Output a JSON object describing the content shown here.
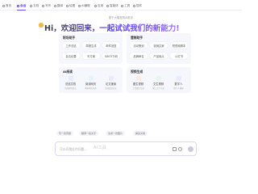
{
  "tabs": [
    {
      "label": "首页",
      "active": false
    },
    {
      "label": "会话",
      "active": true
    },
    {
      "label": "文档",
      "active": false
    },
    {
      "label": "写作",
      "active": false
    },
    {
      "label": "翻译",
      "active": false
    },
    {
      "label": "绘图",
      "active": false
    },
    {
      "label": "AI编程",
      "active": false
    },
    {
      "label": "应用",
      "active": false
    },
    {
      "label": "智能体",
      "active": false
    },
    {
      "label": "工具",
      "active": false
    },
    {
      "label": "插件",
      "active": false
    }
  ],
  "subtitle": "基于大模型的AI助手",
  "greeting": "Hi，欢迎回来，一起试试我们的新能力!",
  "cards": {
    "left_top": {
      "title": "职场助手",
      "items": [
        "工作总结",
        "周报生成",
        "邮件回复",
        "会议纪要",
        "写方案",
        "SWOT分析"
      ]
    },
    "right_top": {
      "title": "营销助手",
      "items": [
        "活动策划",
        "营销文案",
        "短视频脚本",
        "品牌命名",
        "产品卖点",
        "小红书"
      ]
    },
    "left_bottom": {
      "title": "AI阅读",
      "items": [
        {
          "label": "总结文档",
          "desc": "快速提炼要点"
        },
        {
          "label": "阅读网页",
          "desc": "解析网页内容"
        },
        {
          "label": "论文速读",
          "desc": "高效阅读论文"
        }
      ]
    },
    "right_bottom": {
      "title": "视频生成",
      "items": [
        {
          "label": "图生视频",
          "desc": "上传图片生成"
        },
        {
          "label": "文生视频",
          "desc": "输入文字生成"
        },
        {
          "label": "数字人",
          "desc": "数字人播报"
        }
      ]
    }
  },
  "suggestions": [
    "写一篇周报",
    "翻译一段文字",
    "生成一张图片",
    "解读文档"
  ],
  "input": {
    "placeholder": "可以问我任何问题...",
    "watermark": "AI工具"
  },
  "colors": {
    "accent": "#6a4cf5",
    "card_bg": "#f6f7fc"
  }
}
